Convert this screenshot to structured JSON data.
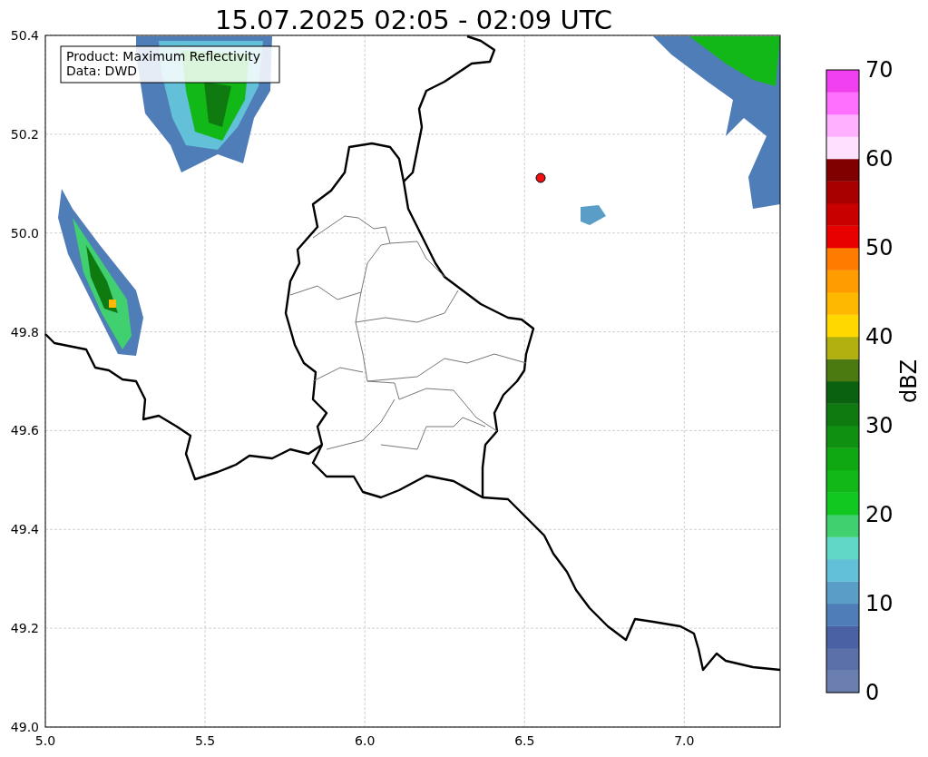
{
  "title": "15.07.2025 02:05 - 02:09 UTC",
  "info_box": {
    "lines": [
      "Product: Maximum Reflectivity",
      "Data: DWD"
    ]
  },
  "map": {
    "xticks": [
      "5.0",
      "5.5",
      "6.0",
      "6.5",
      "7.0"
    ],
    "yticks": [
      "50.4",
      "50.2",
      "50.0",
      "49.8",
      "49.6",
      "49.4",
      "49.2",
      "49.0"
    ]
  },
  "colorbar": {
    "label": "dBZ",
    "ticks": [
      "70",
      "60",
      "50",
      "40",
      "30",
      "20",
      "10",
      "0"
    ],
    "bands": [
      {
        "color": "#6a7fb0"
      },
      {
        "color": "#5b6fa8"
      },
      {
        "color": "#4a62a4"
      },
      {
        "color": "#4f7db8"
      },
      {
        "color": "#5a9ec8"
      },
      {
        "color": "#62c0d8"
      },
      {
        "color": "#60d8c8"
      },
      {
        "color": "#40d070"
      },
      {
        "color": "#10c820"
      },
      {
        "color": "#12b818"
      },
      {
        "color": "#10a810"
      },
      {
        "color": "#109010"
      },
      {
        "color": "#0e7a10"
      },
      {
        "color": "#0a6210"
      },
      {
        "color": "#4a7a10"
      },
      {
        "color": "#b0b010"
      },
      {
        "color": "#ffd800"
      },
      {
        "color": "#ffb800"
      },
      {
        "color": "#ff9c00"
      },
      {
        "color": "#ff7c00"
      },
      {
        "color": "#e80000"
      },
      {
        "color": "#c80000"
      },
      {
        "color": "#a80000"
      },
      {
        "color": "#800000"
      },
      {
        "color": "#ffe0ff"
      },
      {
        "color": "#ffb0ff"
      },
      {
        "color": "#ff70ff"
      },
      {
        "color": "#f040f0"
      }
    ]
  }
}
